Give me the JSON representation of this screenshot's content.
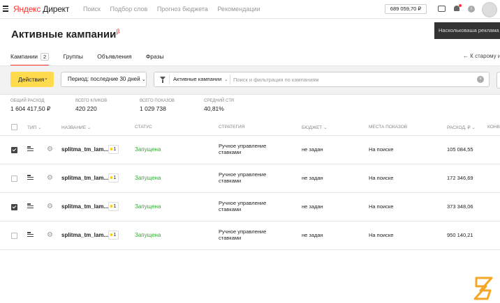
{
  "header": {
    "logo_ya": "Яндекс",
    "logo_rest": " Директ",
    "nav": [
      "Поиск",
      "Подбор слов",
      "Прогноз бюджета",
      "Рекомендации"
    ],
    "balance": "689 059,70 ₽",
    "info_label": "i"
  },
  "page": {
    "title": "Активные кампании",
    "beta": "β",
    "toast": "Наскольковаша реклама э"
  },
  "tabs": [
    {
      "label": "Кампании",
      "count": "2"
    },
    {
      "label": "Группы"
    },
    {
      "label": "Объявления"
    },
    {
      "label": "Фразы"
    }
  ],
  "old_interface_link": "← К старому и",
  "toolbar": {
    "actions_label": "Действия",
    "period_label": "Период: последние 30 дней",
    "filter_chip": "Активные кампании",
    "search_placeholder": "Поиск и фильтрация по кампаниям",
    "clear_label": "×"
  },
  "stats": [
    {
      "label": "Общий расход",
      "value": "1 604 417,50 ₽"
    },
    {
      "label": "Всего кликов",
      "value": "420 220"
    },
    {
      "label": "Всего показов",
      "value": "1 029 738"
    },
    {
      "label": "Средний CTR",
      "value": "40,81%"
    }
  ],
  "columns": {
    "type": "Тип",
    "name": "Название",
    "status": "Статус",
    "strategy": "Стратегия",
    "budget": "Бюджет",
    "places": "Места показов",
    "spend": "Расход, ₽",
    "conv": "Конв"
  },
  "rows": [
    {
      "checked": true,
      "name": "splitma_tm_lam...",
      "badge": "1",
      "status": "Запущена",
      "strategy": "Ручное управление ставками",
      "budget": "не задан",
      "places": "На поиске",
      "spend": "105 084,55"
    },
    {
      "checked": false,
      "name": "splitma_tm_lam...",
      "badge": "1",
      "status": "Запущена",
      "strategy": "Ручное управление ставками",
      "budget": "не задан",
      "places": "На поиске",
      "spend": "172 346,69"
    },
    {
      "checked": true,
      "name": "splitma_tm_lam...",
      "badge": "1",
      "status": "Запущена",
      "strategy": "Ручное управление ставками",
      "budget": "не задан",
      "places": "На поиске",
      "spend": "373 348,06"
    },
    {
      "checked": false,
      "name": "splitma_tm_lam...",
      "badge": "1",
      "status": "Запущена",
      "strategy": "Ручное управление ставками",
      "budget": "не задан",
      "places": "На поиске",
      "spend": "950 140,21"
    }
  ],
  "colors": {
    "brand_red": "#ff3333",
    "action_yellow": "#ffdb4d",
    "status_green": "#33aa33",
    "watermark_orange": "#f5a623"
  }
}
